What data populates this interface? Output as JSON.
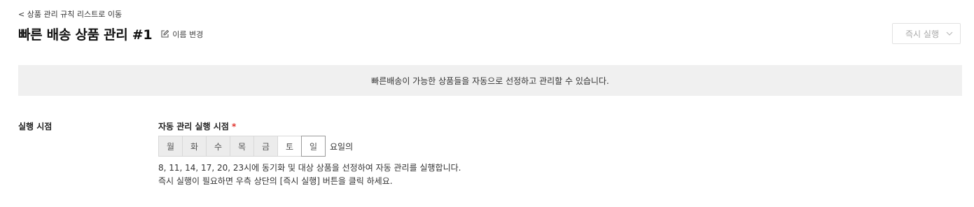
{
  "header": {
    "back_link": "< 상품 관리 규칙 리스트로 이동",
    "title": "빠른 배송 상품 관리 #1",
    "rename_label": "이름 변경",
    "run_select": {
      "selected": "즉시 실행"
    }
  },
  "banner": {
    "text": "빠른배송이 가능한 상품들을 자동으로 선정하고 관리할 수 있습니다."
  },
  "schedule": {
    "section_label": "실행 시점",
    "field_label": "자동 관리 실행 시점",
    "required_mark": "*",
    "days": [
      {
        "label": "월",
        "selected": true
      },
      {
        "label": "화",
        "selected": true
      },
      {
        "label": "수",
        "selected": true
      },
      {
        "label": "목",
        "selected": true
      },
      {
        "label": "금",
        "selected": true
      },
      {
        "label": "토",
        "selected": false
      },
      {
        "label": "일",
        "selected": false
      }
    ],
    "days_suffix": "요일의",
    "description_line1": "8, 11, 14, 17, 20, 23시에 동기화 및 대상 상품을 선정하여 자동 관리를 실행합니다.",
    "description_line2": "즉시 실행이 필요하면 우측 상단의 [즉시 실행] 버튼을 클릭 하세요."
  },
  "icons": {
    "rename": "edit-icon",
    "dropdown": "chevron-down-icon"
  },
  "colors": {
    "banner_bg": "#f0f0f0",
    "selected_day_bg": "#ececec",
    "required": "#e0302a"
  }
}
